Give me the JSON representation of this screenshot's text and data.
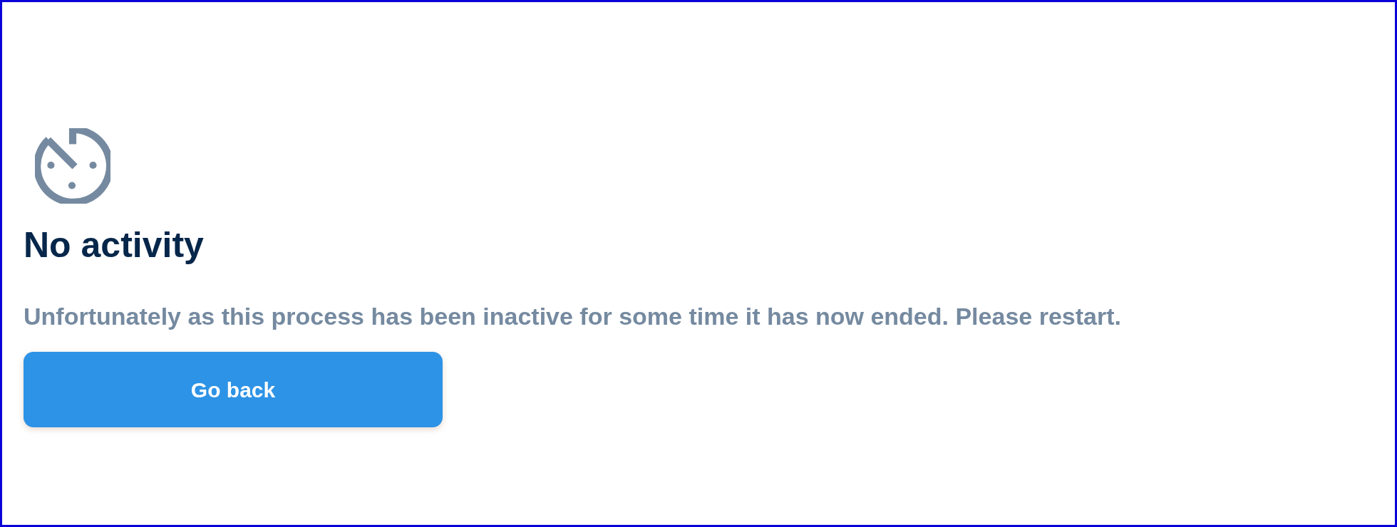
{
  "title": "No activity",
  "message": "Unfortunately as this process has been inactive for some time it has now ended. Please restart.",
  "button": {
    "label": "Go back"
  }
}
